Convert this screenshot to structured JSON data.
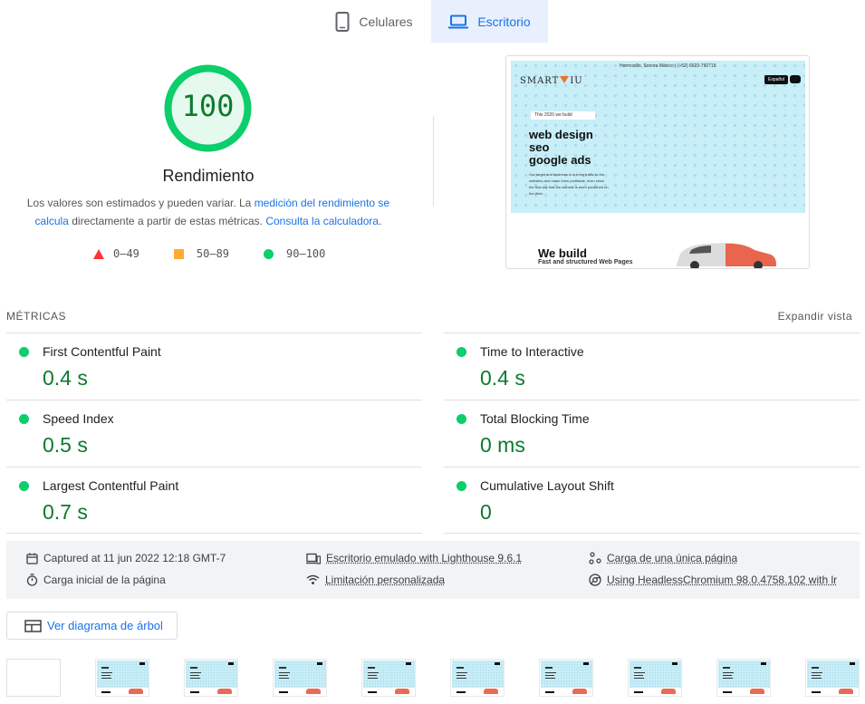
{
  "tabs": [
    {
      "label": "Celulares",
      "icon": "smartphone-icon",
      "active": false
    },
    {
      "label": "Escritorio",
      "icon": "laptop-icon",
      "active": true
    }
  ],
  "score": {
    "value": "100",
    "fraction": 1.0,
    "title": "Rendimiento",
    "desc_part1": "Los valores son estimados y pueden variar. La ",
    "desc_link1": "medición del rendimiento se calcula",
    "desc_part2": " directamente a partir de estas métricas. ",
    "desc_link2": "Consulta la calculadora",
    "desc_part3": "."
  },
  "legend": [
    {
      "label": "0–49",
      "color": "#ff3333",
      "shape": "triangle"
    },
    {
      "label": "50–89",
      "color": "#ffaa33",
      "shape": "square"
    },
    {
      "label": "90–100",
      "color": "#0cce6b",
      "shape": "circle"
    }
  ],
  "screenshot": {
    "topline": "Hermosillo, Sonora México | (+52) 6623-792715",
    "logo_left": "SMART",
    "logo_right": "IU",
    "lang": "Español",
    "pill": "This 2020 we build",
    "headline": [
      "web design",
      "seo",
      "google ads"
    ],
    "small": "Our target and business is to bring traffic to the websites and make them profitable, even since the first day that the website is been published on the Web.",
    "bottom_title": "We build",
    "bottom_sub": "Fast and structured Web Pages"
  },
  "metrics": {
    "header": "MÉTRICAS",
    "expand": "Expandir vista",
    "items": [
      {
        "name": "First Contentful Paint",
        "value": "0.4 s"
      },
      {
        "name": "Time to Interactive",
        "value": "0.4 s"
      },
      {
        "name": "Speed Index",
        "value": "0.5 s"
      },
      {
        "name": "Total Blocking Time",
        "value": "0 ms"
      },
      {
        "name": "Largest Contentful Paint",
        "value": "0.7 s"
      },
      {
        "name": "Cumulative Layout Shift",
        "value": "0"
      }
    ],
    "status_color": "#0cce6b",
    "value_color": "#0d7a2e"
  },
  "info": {
    "captured": "Captured at 11 jun 2022 12:18 GMT-7",
    "load": "Carga inicial de la página",
    "emulated": "Escritorio emulado with Lighthouse 9.6.1",
    "throttle": "Limitación personalizada",
    "single": "Carga de una única página",
    "browser": "Using HeadlessChromium 98.0.4758.102 with lr"
  },
  "tree_button": "Ver diagrama de árbol"
}
